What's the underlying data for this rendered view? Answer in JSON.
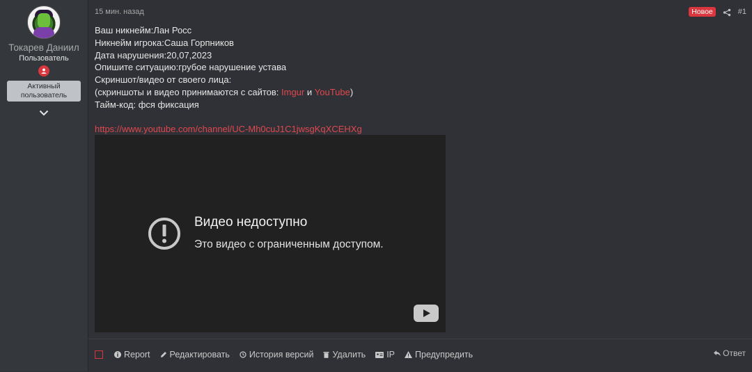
{
  "user": {
    "name": "Токарев Даниил",
    "title": "Пользователь",
    "banner": "Активный пользователь"
  },
  "post": {
    "time": "15 мин. назад",
    "badge_new": "Новое",
    "number": "#1",
    "lines": [
      "Ваш никнейм:Лан Росс",
      "Никнейм игрока:Саша Горпников",
      "Дата нарушения:20,07,2023",
      "Опишите ситуацию:грубое нарушение устава",
      "Скриншот/видео от своего лица:"
    ],
    "screens_prefix": "(скриншоты и видео принимаются с сайтов: ",
    "screens_link1": "Imgur",
    "screens_and": " и ",
    "screens_link2": "YouTube",
    "screens_suffix": ")",
    "timecode": "Тайм-код: фся фиксация",
    "link": "https://www.youtube.com/channel/UC-Mh0cuJ1C1jwsgKqXCEHXg"
  },
  "video": {
    "title": "Видео недоступно",
    "subtitle": "Это видео с ограниченным доступом."
  },
  "actions": {
    "report": "Report",
    "edit": "Редактировать",
    "history": "История версий",
    "delete": "Удалить",
    "ip": "IP",
    "warn": "Предупредить",
    "reply": "Ответ"
  },
  "colors": {
    "accent_red": "#d9363e",
    "link_red": "#e0474f",
    "background": "#2f3136"
  }
}
